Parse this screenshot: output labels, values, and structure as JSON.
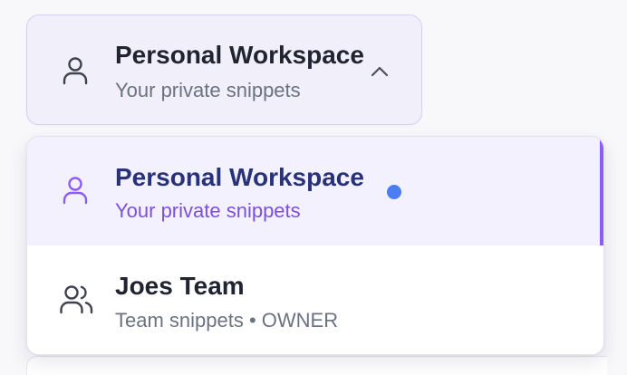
{
  "switcher": {
    "title": "Personal Workspace",
    "subtitle": "Your private snippets",
    "icon": "user-icon",
    "chevron": "chevron-up-icon"
  },
  "dropdown": {
    "options": [
      {
        "title": "Personal Workspace",
        "subtitle": "Your private snippets",
        "icon": "user-icon",
        "selected": true
      },
      {
        "title": "Joes Team",
        "subtitle": "Team snippets • OWNER",
        "icon": "users-icon",
        "selected": false
      }
    ]
  },
  "colors": {
    "accent": "#8b5cf6",
    "selected_title": "#273279",
    "selected_subtitle": "#7c4fe0",
    "active_dot": "#4c7ef3"
  }
}
